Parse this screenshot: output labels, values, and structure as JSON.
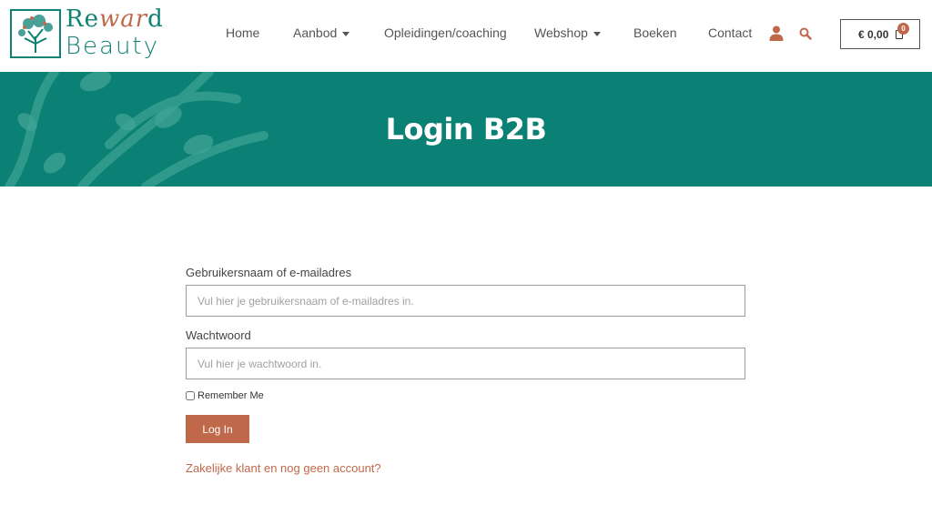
{
  "brand": {
    "word1_part1": "Re",
    "word1_accent": "war",
    "word1_part2": "d",
    "word2": "Beauty"
  },
  "nav": {
    "home": "Home",
    "aanbod": "Aanbod",
    "opleidingen": "Opleidingen/coaching",
    "webshop": "Webshop",
    "boeken": "Boeken",
    "contact": "Contact"
  },
  "cart": {
    "total": "€ 0,00",
    "count": "0"
  },
  "banner": {
    "title": "Login B2B"
  },
  "form": {
    "username_label": "Gebruikersnaam of e-mailadres",
    "username_placeholder": "Vul hier je gebruikersnaam of e-mailadres in.",
    "password_label": "Wachtwoord",
    "password_placeholder": "Vul hier je wachtwoord in.",
    "remember_label": "Remember Me",
    "login_button": "Log In",
    "account_link": "Zakelijke klant en nog geen account?"
  },
  "colors": {
    "primary": "#0b8074",
    "accent": "#c0694a"
  },
  "icons": {
    "user": "user-icon",
    "search": "search-icon",
    "cart": "shopping-bag-icon"
  }
}
